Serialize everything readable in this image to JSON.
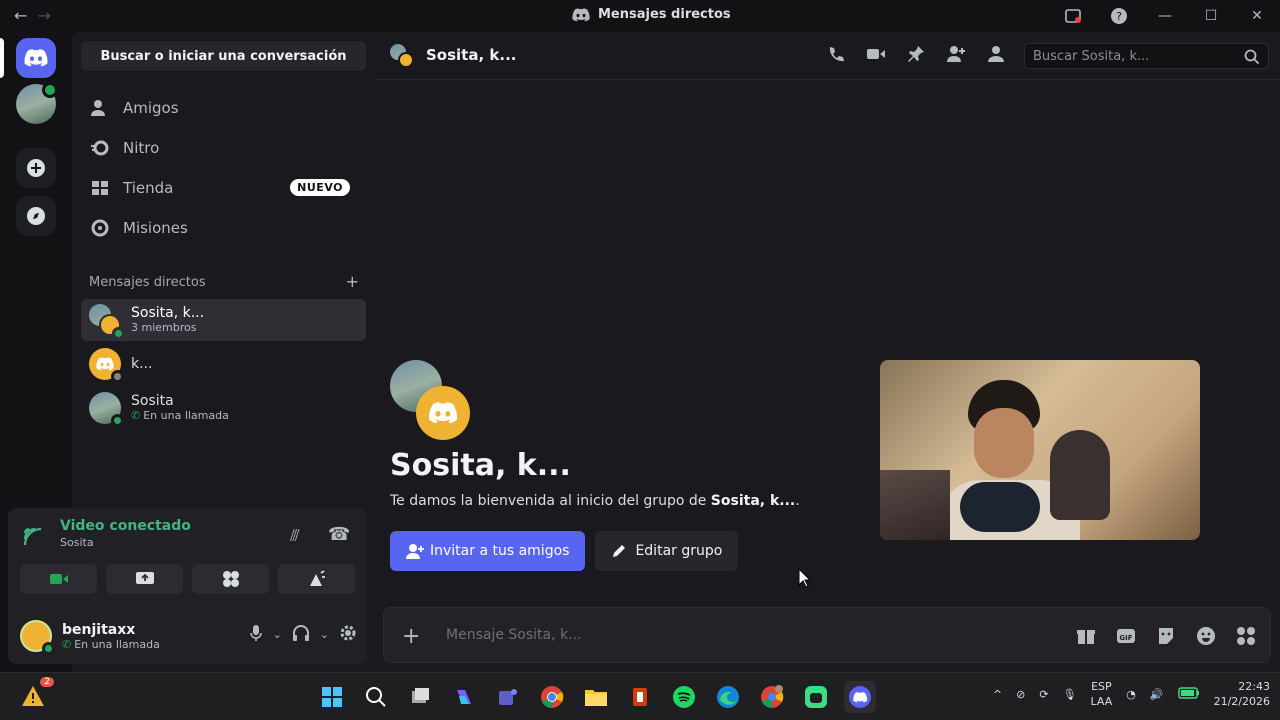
{
  "titlebar": {
    "title": "Mensajes directos",
    "back_glyph": "←",
    "forward_glyph": "→"
  },
  "sidebar": {
    "search_label": "Buscar o iniciar una conversación",
    "nav": [
      {
        "label": "Amigos",
        "icon": "friends-icon"
      },
      {
        "label": "Nitro",
        "icon": "nitro-icon"
      },
      {
        "label": "Tienda",
        "icon": "shop-icon",
        "badge": "NUEVO"
      },
      {
        "label": "Misiones",
        "icon": "quests-icon"
      }
    ],
    "dm_header": "Mensajes directos",
    "dms": [
      {
        "name": "Sosita, k...",
        "sub": "3 miembros"
      },
      {
        "name": "k...",
        "sub": ""
      },
      {
        "name": "Sosita",
        "sub": "En una llamada"
      }
    ]
  },
  "voice": {
    "title": "Video conectado",
    "channel": "Sosita"
  },
  "user": {
    "name": "benjitaxx",
    "status": "En una llamada"
  },
  "channel": {
    "name": "Sosita, k...",
    "search_placeholder": "Buscar Sosita, k...",
    "welcome_title": "Sosita, k...",
    "welcome_desc_prefix": "Te damos la bienvenida al inicio del grupo de ",
    "welcome_desc_bold": "Sosita, k...",
    "welcome_desc_suffix": ".",
    "invite_label": "Invitar a tus amigos",
    "edit_label": "Editar grupo",
    "message_placeholder": "Mensaje Sosita, k..."
  },
  "taskbar": {
    "lang_top": "ESP",
    "lang_bottom": "LAA",
    "time": "22:43",
    "date": "21/2/2026",
    "notif_count": "2"
  },
  "colors": {
    "blurple": "#5865f2",
    "online": "#23a55a",
    "connected": "#43b581",
    "discord_yellow": "#f0b232"
  }
}
